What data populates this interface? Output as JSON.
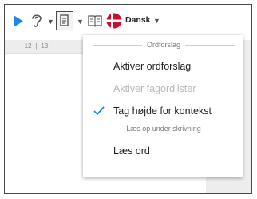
{
  "toolbar": {
    "language_label": "Dansk",
    "flag_color_red": "#c8102e",
    "play_color": "#1e88e5"
  },
  "ruler": {
    "text": "·12·  |  ·13·  |  ·"
  },
  "menu": {
    "section1_label": "Ordforslag",
    "item_enable_suggestions": "Aktiver ordforslag",
    "item_enable_lists": "Aktiver fagordlister",
    "item_context": "Tag højde for kontekst",
    "item_context_checked": true,
    "section2_label": "Læs op under skrivning",
    "item_read_words": "Læs ord"
  }
}
